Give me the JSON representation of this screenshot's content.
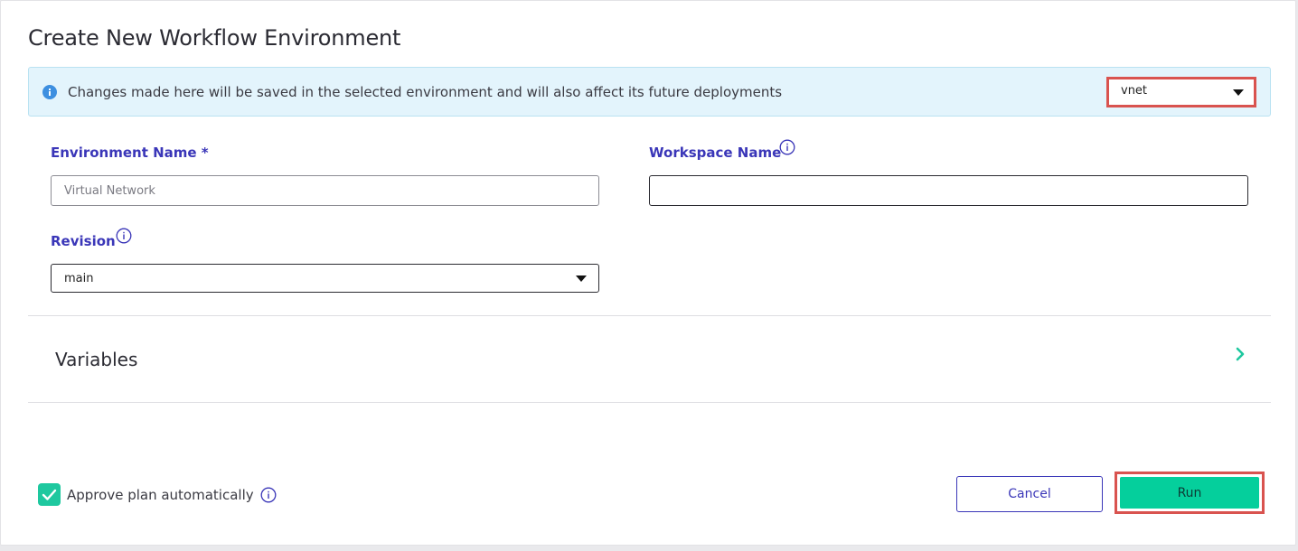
{
  "dialog": {
    "title": "Create New Workflow Environment"
  },
  "banner": {
    "icon": "info-filled-icon",
    "message": "Changes made here will be saved in the selected environment and will also affect its future deployments",
    "environment_select": {
      "value": "vnet"
    }
  },
  "form": {
    "environment_name": {
      "label": "Environment Name *",
      "value": "",
      "placeholder": "Virtual Network"
    },
    "workspace_name": {
      "label": "Workspace Name",
      "value": "",
      "placeholder": ""
    },
    "revision": {
      "label": "Revision",
      "value": "main"
    }
  },
  "variables": {
    "title": "Variables",
    "expand_icon": "chevron-right-icon"
  },
  "footer": {
    "approve_checkbox": {
      "checked": true,
      "label": "Approve plan automatically"
    },
    "cancel_label": "Cancel",
    "run_label": "Run"
  },
  "colors": {
    "accent_primary": "#05cf9c",
    "label_blue": "#3a36b8",
    "highlight_red": "#d9534f",
    "info_banner_bg": "#e3f4fc"
  }
}
